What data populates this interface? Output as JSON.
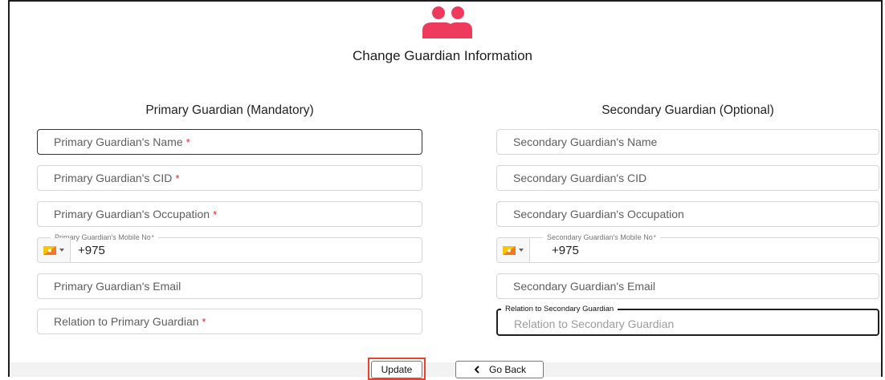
{
  "header": {
    "icon": "guardians-icon",
    "title": "Change Guardian Information"
  },
  "colors": {
    "accent": "#ee3a5c",
    "highlight": "#e8412e",
    "required": "#e0202a"
  },
  "primary": {
    "title": "Primary Guardian (Mandatory)",
    "name_ph": "Primary Guardian's Name",
    "cid_ph": "Primary Guardian's CID",
    "occupation_ph": "Primary Guardian's Occupation",
    "mobile_label": "Primary Guardian's Mobile No",
    "mobile_value": "+975",
    "email_ph": "Primary Guardian's Email",
    "relation_ph": "Relation to Primary Guardian"
  },
  "secondary": {
    "title": "Secondary Guardian (Optional)",
    "name_ph": "Secondary Guardian's Name",
    "cid_ph": "Secondary Guardian's CID",
    "occupation_ph": "Secondary Guardian's Occupation",
    "mobile_label": "Secondary Guardian's Mobile No",
    "mobile_value": "+975",
    "email_ph": "Secondary Guardian's Email",
    "relation_label": "Relation to Secondary Guardian",
    "relation_ph": "Relation to Secondary Guardian"
  },
  "required_mark": "*",
  "actions": {
    "update_label": "Update",
    "back_label": "Go Back"
  }
}
